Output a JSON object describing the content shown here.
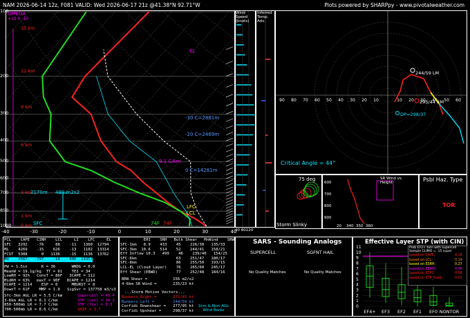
{
  "header": {
    "title": "NAM 2026-06-14 12z, F081  VALID: Wed 2026-06-17 21z @41.38°N 92.71°W",
    "credit": "Plots powered by SHARPpy - www.pivotalweather.com"
  },
  "skewt": {
    "pressure_ticks": [
      "100",
      "200",
      "300",
      "400",
      "500",
      "600",
      "700",
      "850",
      "1000"
    ],
    "temp_ticks": [
      "-40",
      "-30",
      "-20",
      "-10",
      "0",
      "10",
      "20",
      "30",
      "40"
    ],
    "height_labels": [
      "15 km",
      "12 km",
      "9 km",
      "6 km",
      "3 km",
      "1 km",
      "0 km"
    ],
    "omega_label": "OMEGA",
    "omega_ticks": "+10  0  -10",
    "el_label": "EL",
    "lfc_label": "LFC",
    "lcl_label": "LCL",
    "sfc_label": "SFC",
    "surface_temp": "74F",
    "surface_dew": "74F",
    "c_labels": [
      "-30 C=2881m",
      "-20 C=2469m",
      "0 C=14281m"
    ],
    "lapse_label": "9.1 C/km",
    "mixed_height": "2170m",
    "mixed_label": "499 m2s2"
  },
  "chart_data": [
    {
      "type": "line",
      "title": "",
      "xlabel": "",
      "ylabel": "",
      "ylim": [
        1000,
        100
      ],
      "xlim": [
        -40,
        40
      ],
      "x_ticks": [
        -40,
        -30,
        -20,
        -10,
        0,
        10,
        20,
        30,
        40
      ],
      "y_ticks": [
        100,
        200,
        300,
        400,
        500,
        600,
        700,
        850,
        1000
      ],
      "series": [
        {
          "color": "#ff2020",
          "x": [
            30,
            24,
            16,
            9,
            2,
            -6,
            -14,
            -22,
            -34,
            -46,
            -58,
            -60,
            -58
          ],
          "y": [
            1000,
            925,
            850,
            775,
            700,
            625,
            550,
            500,
            400,
            300,
            250,
            200,
            100
          ]
        },
        {
          "color": "#20e020",
          "x": [
            24,
            22,
            16,
            8,
            -4,
            -16,
            -28,
            -40,
            -52,
            -60,
            -68,
            -75,
            -80
          ],
          "y": [
            1000,
            925,
            850,
            775,
            700,
            625,
            550,
            500,
            400,
            300,
            250,
            200,
            100
          ]
        }
      ]
    },
    {
      "type": "scatter",
      "title": "",
      "xlim": [
        -100,
        100
      ],
      "ylim": [
        -100,
        100
      ],
      "x_ticks": [
        90,
        80,
        70,
        60,
        50,
        40,
        30,
        20,
        10,
        10,
        20,
        30,
        40,
        50,
        60,
        70,
        80,
        90
      ],
      "points": [
        {
          "label": "244/59 LM"
        },
        {
          "label": "295/44 RM"
        },
        {
          "label": "DP=298/37"
        }
      ]
    },
    {
      "type": "bar",
      "title": "Effective Layer STP (with CIN)",
      "categories": [
        "EF4+",
        "EF3",
        "EF2",
        "EF1",
        "EF0",
        "NONTOR"
      ],
      "ylim": [
        0,
        11
      ],
      "y_ticks": [
        0,
        1,
        2,
        3,
        4,
        5,
        6,
        7,
        8,
        9,
        10,
        11
      ],
      "box": [
        {
          "low": 1.6,
          "q1": 3.5,
          "med": 5.6,
          "q3": 7.5,
          "high": 10.0
        },
        {
          "low": 0.6,
          "q1": 1.8,
          "med": 3.1,
          "q3": 5.2,
          "high": 8.0
        },
        {
          "low": 0.2,
          "q1": 1.4,
          "med": 2.6,
          "q3": 4.0,
          "high": 7.3
        },
        {
          "low": 0,
          "q1": 0.8,
          "med": 1.6,
          "q3": 3.0,
          "high": 5.0
        },
        {
          "low": 0,
          "q1": 0.2,
          "med": 0.8,
          "q3": 2.0,
          "high": 3.6
        },
        {
          "low": 0,
          "q1": 0,
          "med": 0.2,
          "q3": 0.6,
          "high": 1.7
        }
      ],
      "labels": [
        "Prob EF2+ torn with supercell",
        "Sample CLIMO = .15 super"
      ]
    }
  ],
  "windspeed_panel": {
    "title": "Wind Speed (knots)",
    "ticks": [
      "40",
      "80",
      "120"
    ]
  },
  "tadv_panel": {
    "title": "Inferred Temp. Adv."
  },
  "critical_angle": "Critical Angle = 44°",
  "storm_slinky": {
    "label": "Storm Slinky",
    "deg": "75 deg"
  },
  "srw_panel": {
    "title": "SR Wind vs. Height",
    "x_ticks": [
      "20",
      "340",
      "350",
      "360"
    ],
    "y_ticks": [
      "600",
      "700",
      "800",
      "900"
    ]
  },
  "haz_type": {
    "title": "Psbl Haz. Type",
    "value": "TOR"
  },
  "params": {
    "parcel_header": "PCL    CAPE   CINH    LCL     LI    LFC     EL",
    "parcel_rows": [
      "SFC   3292    -76     88    -11   1360  12794",
      "ML    4269    -15    626    -13   1102  13314",
      "FCST  5308      0   1136    -15   1136  13762",
      "MU    4567   -797    -14    900  13357"
    ],
    "thermo_rows": [
      "PW = 1.5in      K = 36       WNDG = 0.0",
      "MeanW = 19.1g/kg  TT = 61    TEI = 34",
      "LowRH = 92%   ConvT = 86F   3CAPE = 112",
      "MidRH = 63%   maxT = 90F   DCAPE = 1214",
      "DCAPE = 1214    ESP = 0      MBURST = 8",
      "DownT = 61F    MMP = 1.0   SigSvr = 137758 m3/s3"
    ],
    "lapse_rows": [
      "Sfc-3km AGL LR = 5.5 C/km",
      "3-6km AGL LR = 8.1 C/km",
      "850-500mb LR = 7.7 C/km",
      "700-500mb LR = 8.6 C/km"
    ],
    "composite_rows": [
      "Supercell = 43.4",
      "STP (cin) = 14.2",
      "STP (fix) = 9.3",
      "SHIP = 3.7"
    ],
    "kin_header": "          EHI    SRH   Bulk Shear   MnWind    SRW",
    "kin_rows": [
      "SFC-1km   8.9    433    45    226/30   135/33",
      "SFC-3km  10.6    514    52    244/41   158/21",
      "Eff Inflow 10.3   499    46    239/40   154/25",
      "SFC-6km                 63    251/47   180/17",
      "SFC-8km                 86    255/50   193/15",
      "LCL-EL (Cloud Layer)    76    265/60   245/17",
      "Eff Shear (EBWD)        77    252/48   184/16"
    ],
    "brn_rows": [
      "BRN Shear =           156 m2/s2",
      "4-6km SR Wind =       235/23 kt"
    ],
    "storm_header": "...Storm Motion Vectors...",
    "storm_rows": [
      "Bunkers Right =       272/45 kt",
      "Bunkers Left =        244/59 kt",
      "Corfidi Downshear =   277/95 kt",
      "Corfidi Upshear =     298/37 kt"
    ],
    "wind_barb_caption": "1km & 6km AGL Wind Barbs"
  },
  "sars": {
    "title": "SARS - Sounding Analogs",
    "col1": "SUPERCELL",
    "col2": "SGFNT HAIL",
    "match1": "No Quality Matches",
    "match2": "No Quality Matches"
  },
  "stp_legend": {
    "prob_title": "Prob EF2+ torn with supercell",
    "sample": "Sample CLIMO = .15 super",
    "rows": [
      {
        "label": "based on CAPE:",
        "val": "0.16"
      },
      {
        "label": "based on LCL:",
        "val": "0.19"
      },
      {
        "label": "based on ESRH:",
        "val": "0.27"
      },
      {
        "label": "based on EBWD:",
        "val": "0.36"
      },
      {
        "label": "based on STPC:",
        "val": "0.58"
      },
      {
        "label": "based on STP_fixed:",
        "val": "0.53"
      }
    ]
  },
  "colors": {
    "temp": "#ff2020",
    "dew": "#20e020",
    "accent": "#ff00ff",
    "cyan": "#00e5ff",
    "yellow": "#ffff00"
  }
}
